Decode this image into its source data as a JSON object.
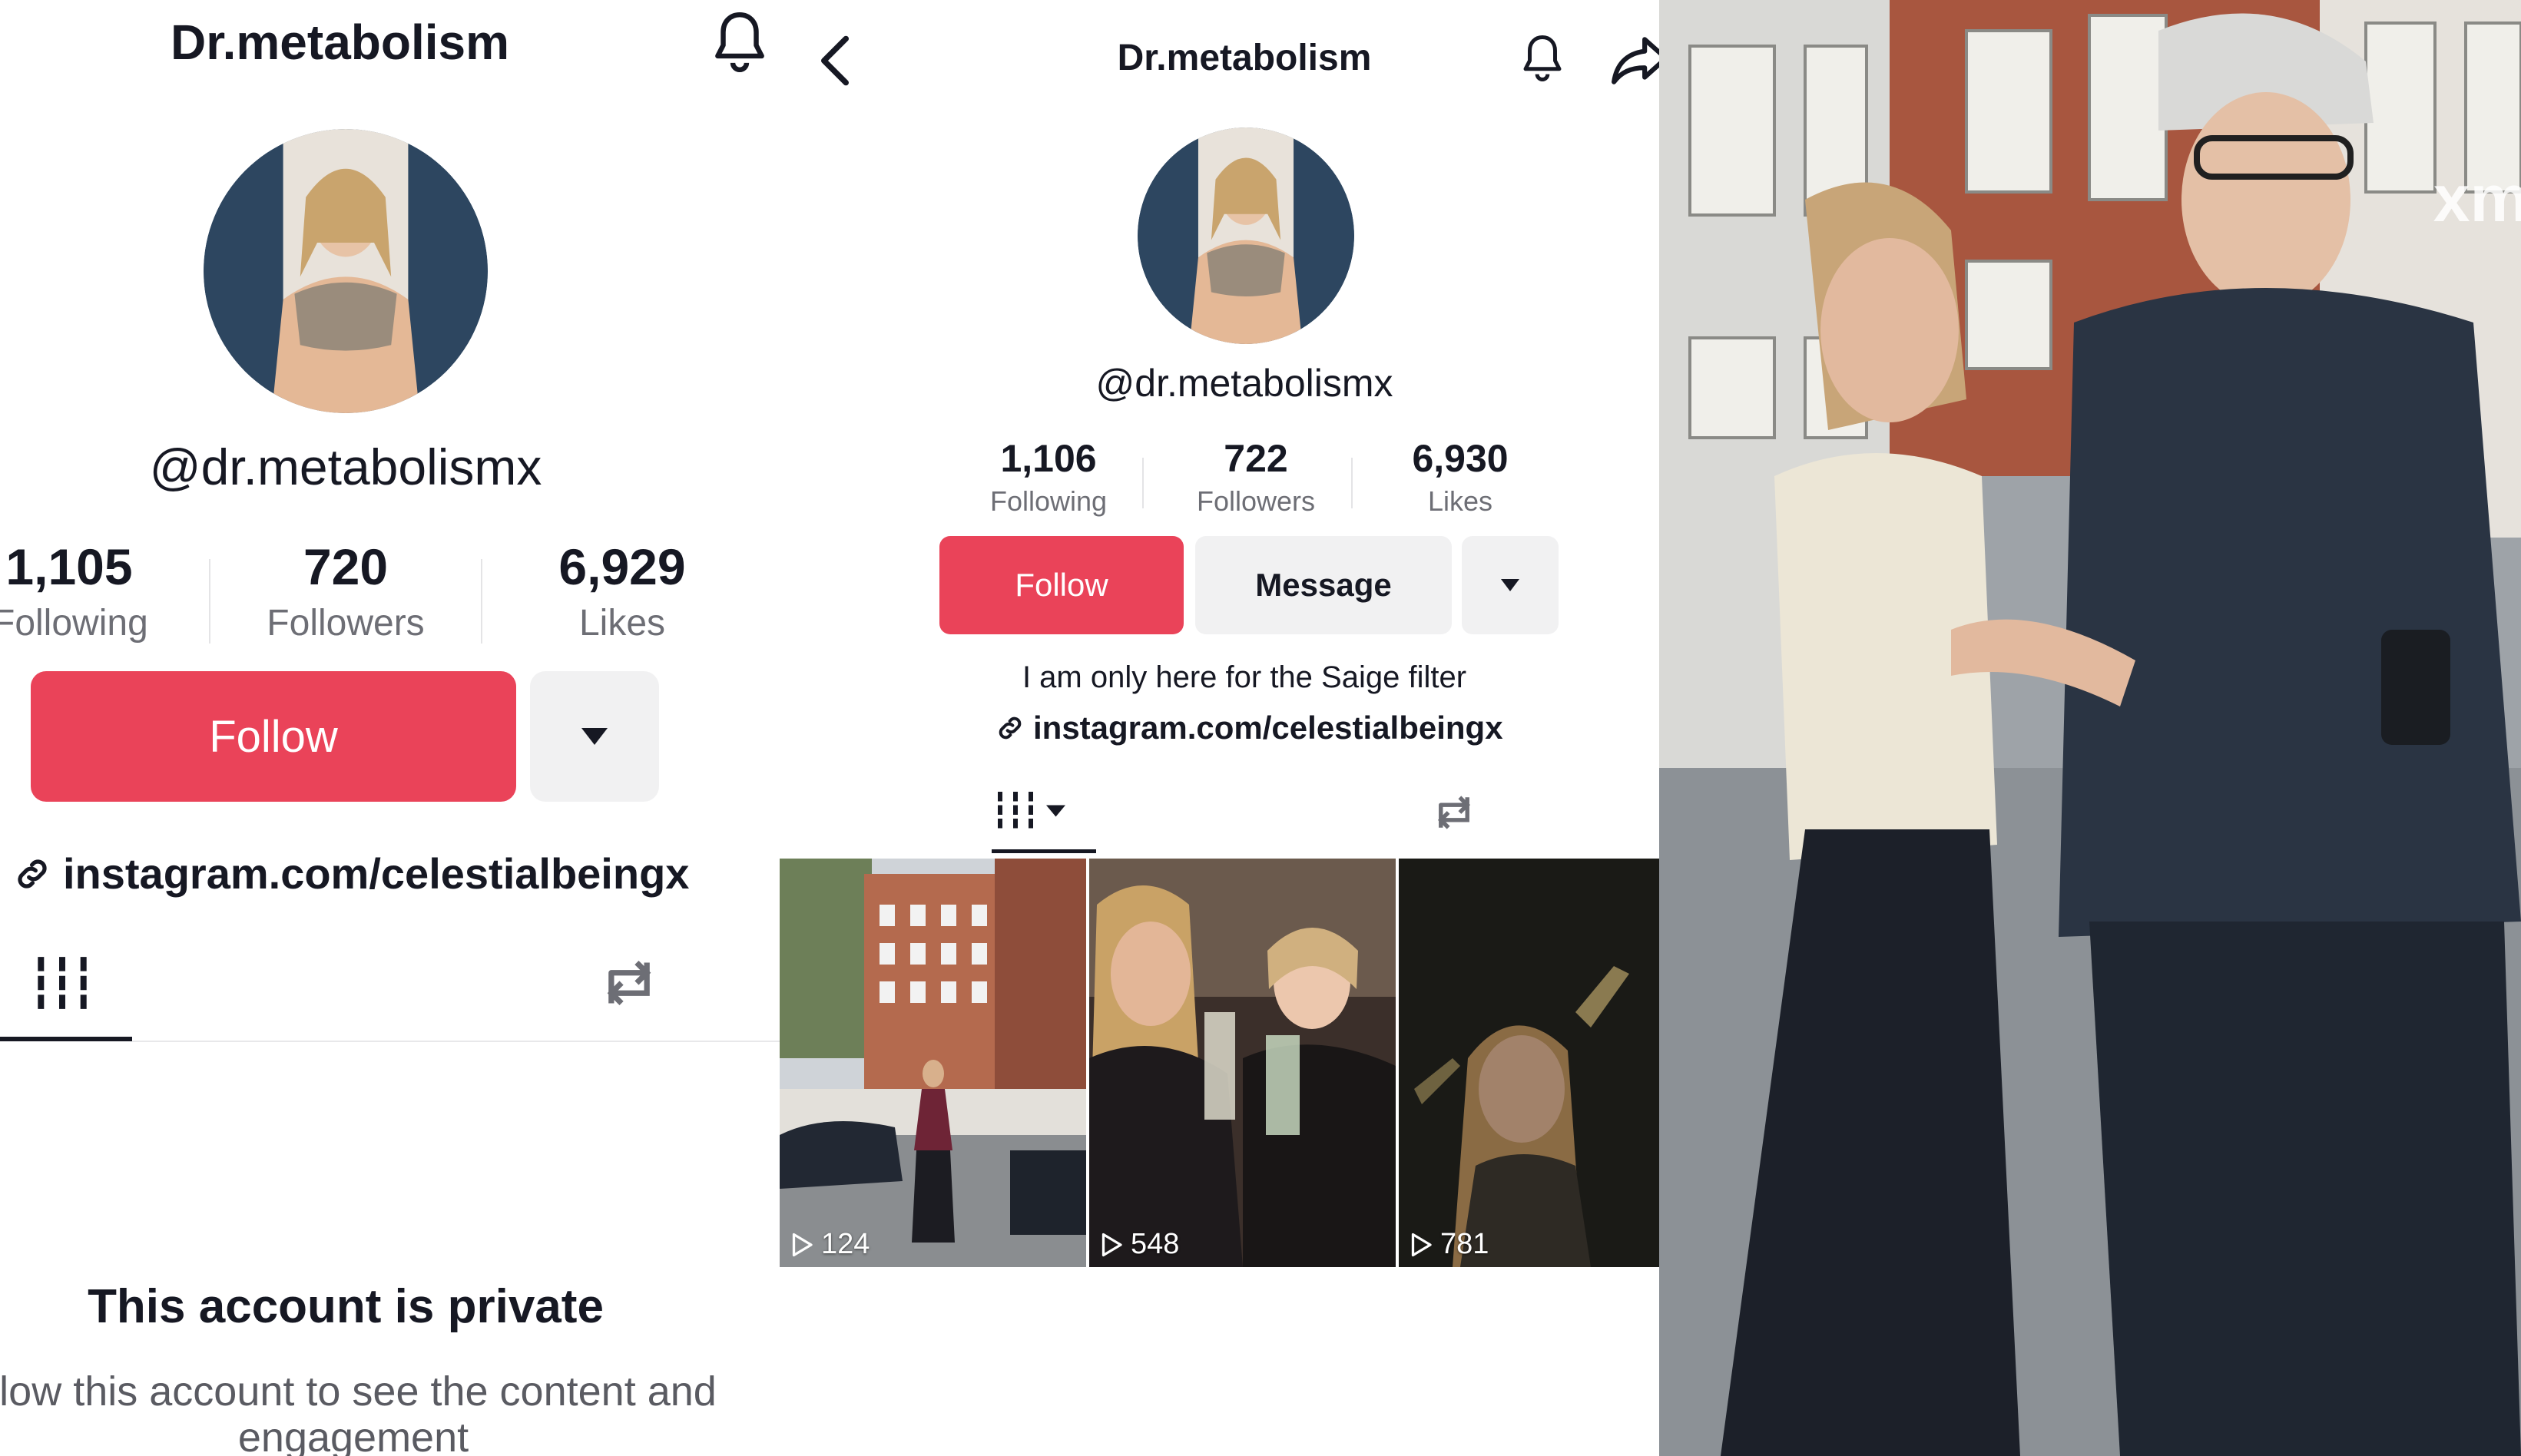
{
  "panel_private": {
    "title": "Dr.metabolism",
    "handle": "@dr.metabolismx",
    "stats": [
      {
        "value": "1,105",
        "label": "Following"
      },
      {
        "value": "720",
        "label": "Followers"
      },
      {
        "value": "6,929",
        "label": "Likes"
      }
    ],
    "follow_label": "Follow",
    "link": "instagram.com/celestialbeingx",
    "private_title": "This account is private",
    "private_subtitle": "llow this account to see the content and engagement"
  },
  "panel_public": {
    "title": "Dr.metabolism",
    "handle": "@dr.metabolismx",
    "stats": [
      {
        "value": "1,106",
        "label": "Following"
      },
      {
        "value": "722",
        "label": "Followers"
      },
      {
        "value": "6,930",
        "label": "Likes"
      }
    ],
    "follow_label": "Follow",
    "message_label": "Message",
    "bio": "I am only here for the Saige filter",
    "link": "instagram.com/celestialbeingx",
    "videos": [
      {
        "views": "124"
      },
      {
        "views": "548"
      },
      {
        "views": "781"
      }
    ]
  },
  "photo": {
    "watermark": "xm"
  },
  "colors": {
    "accent": "#ea4359",
    "secondary_button": "#f1f1f2",
    "muted_text": "#6d6e75"
  },
  "icons": [
    "bell-icon",
    "back-arrow-icon",
    "share-icon",
    "caret-down-icon",
    "link-icon",
    "grid-icon",
    "repost-icon",
    "play-icon"
  ]
}
